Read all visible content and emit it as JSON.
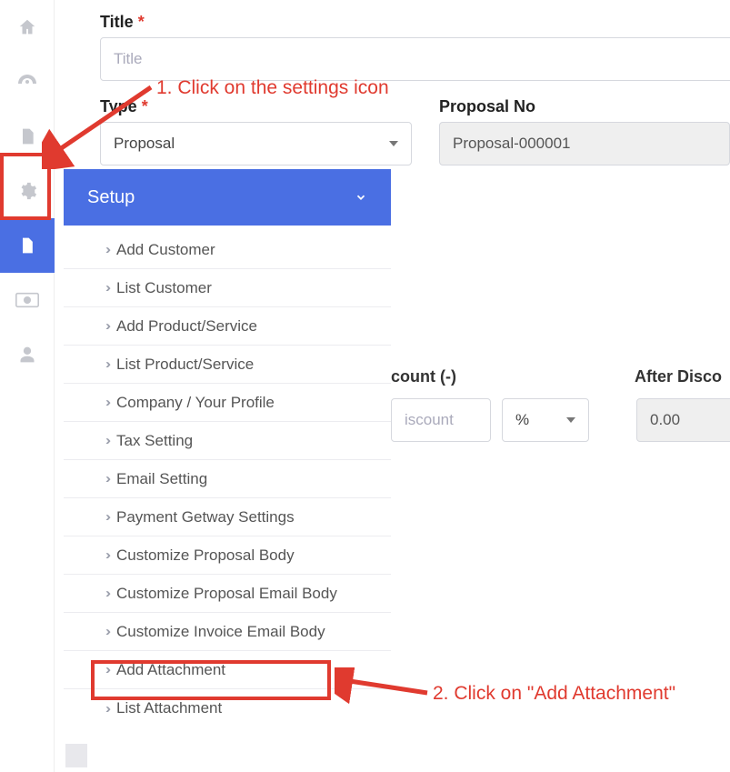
{
  "sidebar": {
    "icons": [
      "home",
      "dashboard",
      "document",
      "gear",
      "page",
      "money",
      "user"
    ],
    "active_index": 4
  },
  "form": {
    "title_label": "Title",
    "title_placeholder": "Title",
    "type_label": "Type",
    "type_value": "Proposal",
    "proposal_no_label": "Proposal No",
    "proposal_no_value": "Proposal-000001",
    "discount_label_partial": "count (-)",
    "discount_placeholder_partial": "iscount",
    "discount_unit": "%",
    "after_discount_label_partial": "After Disco",
    "after_discount_value": "0.00"
  },
  "setup": {
    "header": "Setup",
    "items": [
      "Add Customer",
      "List Customer",
      "Add Product/Service",
      "List Product/Service",
      "Company / Your Profile",
      "Tax Setting",
      "Email Setting",
      "Payment Getway Settings",
      "Customize Proposal Body",
      "Customize Proposal Email Body",
      "Customize Invoice Email Body",
      "Add Attachment",
      "List Attachment"
    ]
  },
  "annotations": {
    "step1": "1. Click on the settings icon",
    "step2": "2. Click on \"Add Attachment\""
  }
}
